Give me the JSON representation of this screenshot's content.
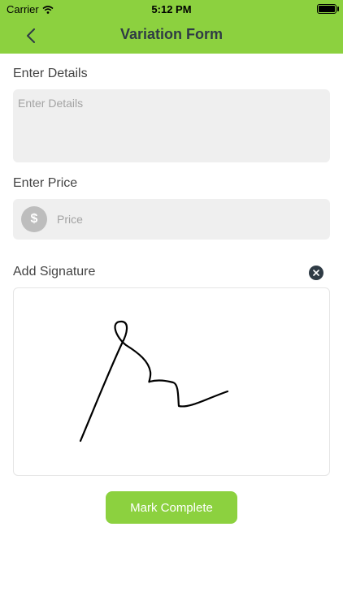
{
  "status_bar": {
    "carrier": "Carrier",
    "time": "5:12 PM"
  },
  "nav": {
    "title": "Variation Form",
    "back_icon": "chevron-left-icon"
  },
  "form": {
    "details_label": "Enter Details",
    "details_placeholder": "Enter Details",
    "price_label": "Enter Price",
    "price_symbol": "$",
    "price_placeholder": "Price",
    "signature_label": "Add Signature"
  },
  "actions": {
    "complete_label": "Mark Complete"
  },
  "colors": {
    "accent": "#8cd13f",
    "title": "#2f3b45",
    "field_bg": "#efefef"
  }
}
